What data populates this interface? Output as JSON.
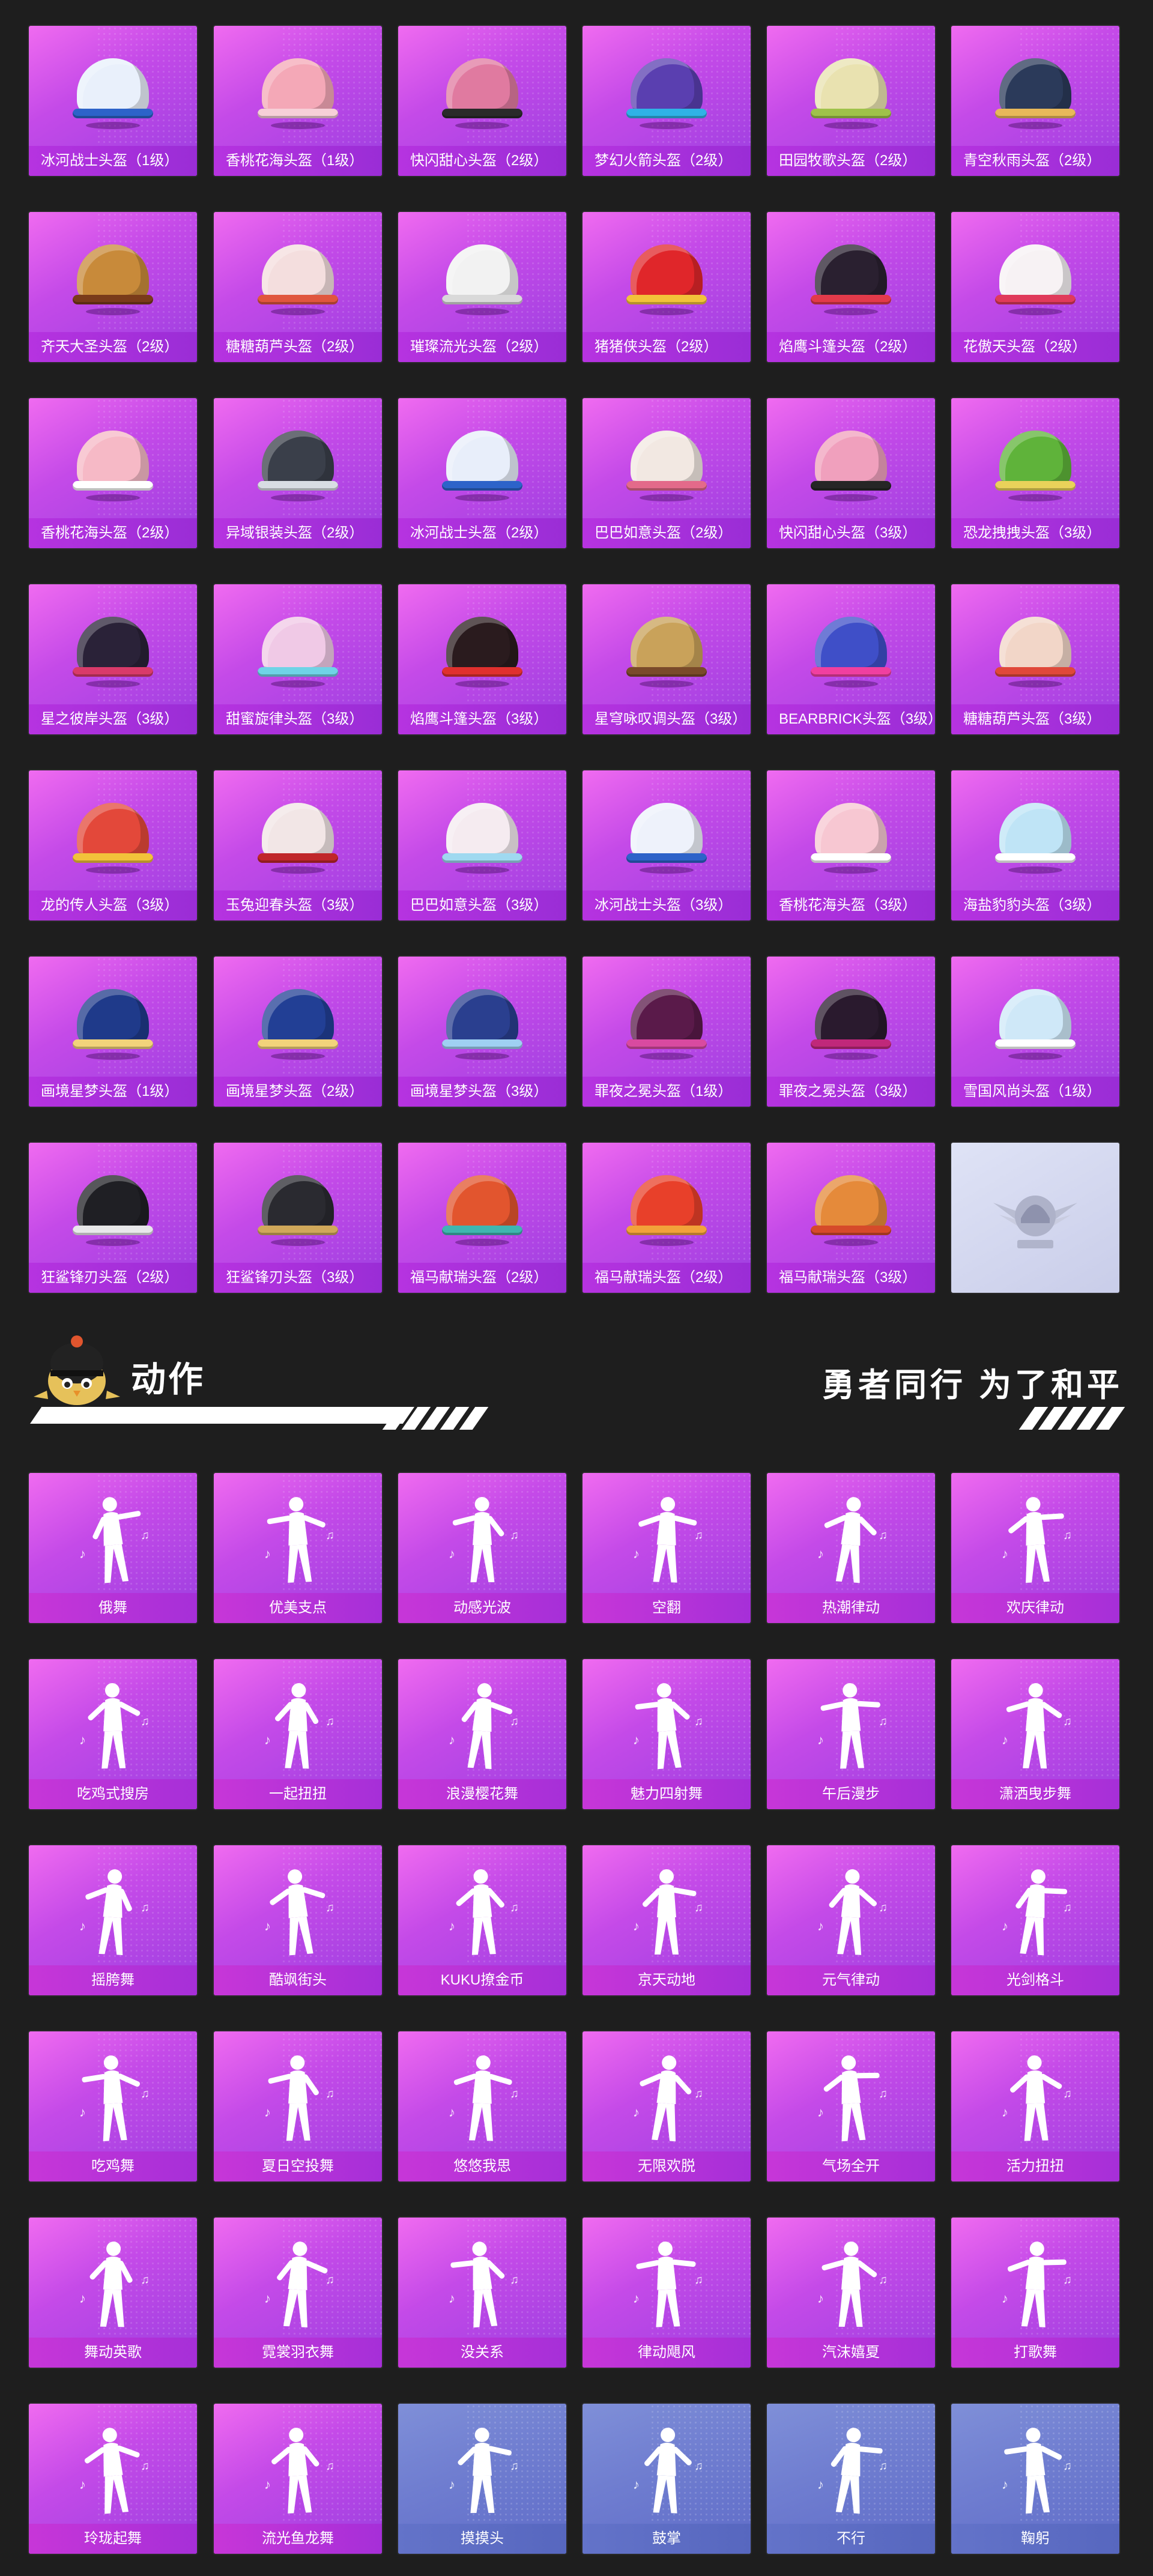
{
  "helmets": [
    {
      "label": "冰河战士头盔（1级）",
      "color": "#e9f0fb",
      "accent": "#2d63c9"
    },
    {
      "label": "香桃花海头盔（1级）",
      "color": "#f4a8b7",
      "accent": "#f7cfd8"
    },
    {
      "label": "快闪甜心头盔（2级）",
      "color": "#e07aa0",
      "accent": "#2a2a2a"
    },
    {
      "label": "梦幻火箭头盔（2级）",
      "color": "#5a3fb0",
      "accent": "#2fb2e6"
    },
    {
      "label": "田园牧歌头盔（2级）",
      "color": "#e9e2b0",
      "accent": "#9fc24a"
    },
    {
      "label": "青空秋雨头盔（2级）",
      "color": "#2b3a5a",
      "accent": "#e8b85a"
    },
    {
      "label": "齐天大圣头盔（2级）",
      "color": "#c88a3a",
      "accent": "#7a3b1a"
    },
    {
      "label": "糖糖葫芦头盔（2级）",
      "color": "#f4dede",
      "accent": "#e0563e"
    },
    {
      "label": "璀璨流光头盔（2级）",
      "color": "#f2f2f2",
      "accent": "#d9d9d9"
    },
    {
      "label": "猪猪侠头盔（2级）",
      "color": "#e0262a",
      "accent": "#f2c23a"
    },
    {
      "label": "焰鹰斗篷头盔（2级）",
      "color": "#2a2030",
      "accent": "#e23a4a"
    },
    {
      "label": "花傲天头盔（2级）",
      "color": "#f7f2f4",
      "accent": "#e03a5a"
    },
    {
      "label": "香桃花海头盔（2级）",
      "color": "#f6b9c6",
      "accent": "#ffffff"
    },
    {
      "label": "异域银装头盔（2级）",
      "color": "#3a3f4a",
      "accent": "#d8dde3"
    },
    {
      "label": "冰河战士头盔（2级）",
      "color": "#e8eefa",
      "accent": "#2d63c9"
    },
    {
      "label": "巴巴如意头盔（2级）",
      "color": "#f2e8e2",
      "accent": "#e36a8a"
    },
    {
      "label": "快闪甜心头盔（3级）",
      "color": "#f0a0bd",
      "accent": "#262626"
    },
    {
      "label": "恐龙拽拽头盔（3级）",
      "color": "#5fb33a",
      "accent": "#e9d25a"
    },
    {
      "label": "星之彼岸头盔（3级）",
      "color": "#2a2238",
      "accent": "#d93a6a"
    },
    {
      "label": "甜蜜旋律头盔（3级）",
      "color": "#f0c9e6",
      "accent": "#6fd3e6"
    },
    {
      "label": "焰鹰斗篷头盔（3级）",
      "color": "#2a1b1e",
      "accent": "#e0302e"
    },
    {
      "label": "星穹咏叹调头盔（3级）",
      "color": "#c9a25a",
      "accent": "#7a4a2a"
    },
    {
      "label": "BEARBRICK头盔（3级）",
      "color": "#3f4fc8",
      "accent": "#f03fa0"
    },
    {
      "label": "糖糖葫芦头盔（3级）",
      "color": "#f2d6c8",
      "accent": "#e0483a"
    },
    {
      "label": "龙的传人头盔（3级）",
      "color": "#e3483a",
      "accent": "#f2c23a"
    },
    {
      "label": "玉兔迎春头盔（3级）",
      "color": "#f2e6e6",
      "accent": "#c0262a"
    },
    {
      "label": "巴巴如意头盔（3级）",
      "color": "#f5ebf0",
      "accent": "#9fd9f0"
    },
    {
      "label": "冰河战士头盔（3级）",
      "color": "#eef2fb",
      "accent": "#2d63c9"
    },
    {
      "label": "香桃花海头盔（3级）",
      "color": "#f7c7d2",
      "accent": "#ffffff"
    },
    {
      "label": "海盐豹豹头盔（3级）",
      "color": "#bfe4f6",
      "accent": "#ffffff"
    },
    {
      "label": "画境星梦头盔（1级）",
      "color": "#1f3a8a",
      "accent": "#f2d37a"
    },
    {
      "label": "画境星梦头盔（2级）",
      "color": "#223f95",
      "accent": "#f2d37a"
    },
    {
      "label": "画境星梦头盔（3级）",
      "color": "#2a3f8f",
      "accent": "#9fd0f2"
    },
    {
      "label": "罪夜之冕头盔（1级）",
      "color": "#5a1a4a",
      "accent": "#d94aa0"
    },
    {
      "label": "罪夜之冕头盔（3级）",
      "color": "#2a1a2e",
      "accent": "#c0287a"
    },
    {
      "label": "雪国风尚头盔（1级）",
      "color": "#cfe8f8",
      "accent": "#ffffff"
    },
    {
      "label": "狂鲨锋刃头盔（2级）",
      "color": "#1f1f24",
      "accent": "#e8e8ea"
    },
    {
      "label": "狂鲨锋刃头盔（3级）",
      "color": "#2a2a30",
      "accent": "#d0a85a"
    },
    {
      "label": "福马献瑞头盔（2级）",
      "color": "#e2552e",
      "accent": "#3fb6b0"
    },
    {
      "label": "福马献瑞头盔（2级）",
      "color": "#e8402a",
      "accent": "#f2a23a"
    },
    {
      "label": "福马献瑞头盔（3级）",
      "color": "#e58a3a",
      "accent": "#d64a2a"
    },
    {
      "label": "",
      "color": "",
      "accent": "",
      "emblem": true
    }
  ],
  "section": {
    "title": "动作",
    "slogan": "勇者同行 为了和平"
  },
  "actions": [
    {
      "label": "俄舞",
      "style": "pink"
    },
    {
      "label": "优美支点",
      "style": "pink"
    },
    {
      "label": "动感光波",
      "style": "pink"
    },
    {
      "label": "空翻",
      "style": "pink"
    },
    {
      "label": "热潮律动",
      "style": "pink"
    },
    {
      "label": "欢庆律动",
      "style": "pink"
    },
    {
      "label": "吃鸡式搜房",
      "style": "pink"
    },
    {
      "label": "一起扭扭",
      "style": "pink"
    },
    {
      "label": "浪漫樱花舞",
      "style": "pink"
    },
    {
      "label": "魅力四射舞",
      "style": "pink"
    },
    {
      "label": "午后漫步",
      "style": "pink"
    },
    {
      "label": "潇洒曳步舞",
      "style": "pink"
    },
    {
      "label": "摇胯舞",
      "style": "pink"
    },
    {
      "label": "酷飒街头",
      "style": "pink"
    },
    {
      "label": "KUKU撩金币",
      "style": "pink"
    },
    {
      "label": "京天动地",
      "style": "pink"
    },
    {
      "label": "元气律动",
      "style": "pink"
    },
    {
      "label": "光剑格斗",
      "style": "pink"
    },
    {
      "label": "吃鸡舞",
      "style": "pink"
    },
    {
      "label": "夏日空投舞",
      "style": "pink"
    },
    {
      "label": "悠悠我思",
      "style": "pink"
    },
    {
      "label": "无限欢脱",
      "style": "pink"
    },
    {
      "label": "气场全开",
      "style": "pink"
    },
    {
      "label": "活力扭扭",
      "style": "pink"
    },
    {
      "label": "舞动英歌",
      "style": "pink"
    },
    {
      "label": "霓裳羽衣舞",
      "style": "pink"
    },
    {
      "label": "没关系",
      "style": "pink"
    },
    {
      "label": "律动飓风",
      "style": "pink"
    },
    {
      "label": "汽沫嬉夏",
      "style": "pink"
    },
    {
      "label": "打歌舞",
      "style": "pink"
    },
    {
      "label": "玲珑起舞",
      "style": "pink"
    },
    {
      "label": "流光鱼龙舞",
      "style": "pink"
    },
    {
      "label": "摸摸头",
      "style": "blue"
    },
    {
      "label": "鼓掌",
      "style": "blue"
    },
    {
      "label": "不行",
      "style": "blue"
    },
    {
      "label": "鞠躬",
      "style": "blue"
    }
  ]
}
